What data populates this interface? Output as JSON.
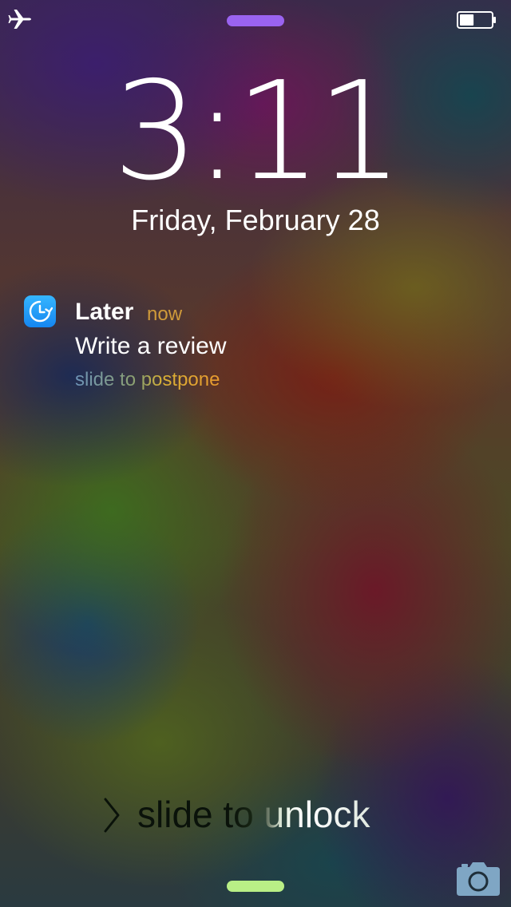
{
  "status_bar": {
    "airplane_icon": "airplane-icon",
    "battery_icon": "battery-icon",
    "battery_level": 0.45
  },
  "lock_screen": {
    "time": "3:11",
    "date": "Friday, February 28"
  },
  "notification": {
    "app_icon": "clock-arrow-icon",
    "app_name": "Later",
    "time_ago": "now",
    "message": "Write a review",
    "action_hint": "slide to postpone"
  },
  "unlock": {
    "chevron_icon": "chevron-right-icon",
    "label": "slide to unlock"
  },
  "camera": {
    "icon": "camera-icon"
  },
  "colors": {
    "grabber_top": "#9a63f0",
    "grabber_bottom": "#b9ef86",
    "app_icon_blue": "#1a8ef5",
    "time_ago": "#cf9a3a"
  }
}
